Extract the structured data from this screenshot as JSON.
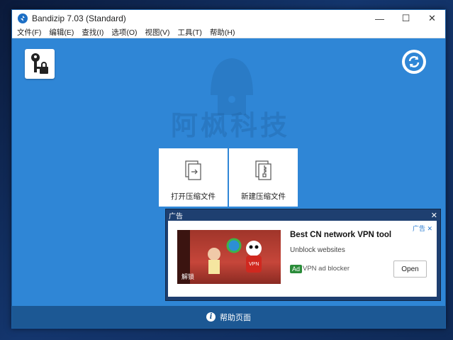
{
  "window": {
    "title": "Bandizip 7.03 (Standard)"
  },
  "controls": {
    "minimize": "—",
    "maximize": "☐",
    "close": "✕"
  },
  "menu": [
    "文件(F)",
    "编辑(E)",
    "查找(I)",
    "选项(O)",
    "视图(V)",
    "工具(T)",
    "帮助(H)"
  ],
  "watermark": {
    "text": "阿枫科技"
  },
  "actions": {
    "open": "打开压缩文件",
    "new": "新建压缩文件"
  },
  "footer": {
    "help": "帮助页面",
    "help_glyph": "i"
  },
  "ad": {
    "header": "广告",
    "close": "✕",
    "choices": "广告 ✕",
    "image_caption": "解锁",
    "image_badge": "VPN",
    "title": "Best CN network VPN tool",
    "subtitle": "Unblock websites",
    "badge": "Ad",
    "advertiser": "VPN ad blocker",
    "cta": "Open"
  },
  "colors": {
    "accent": "#2f86d6",
    "footer": "#1c5894",
    "ad_frame": "#1e3f70"
  }
}
